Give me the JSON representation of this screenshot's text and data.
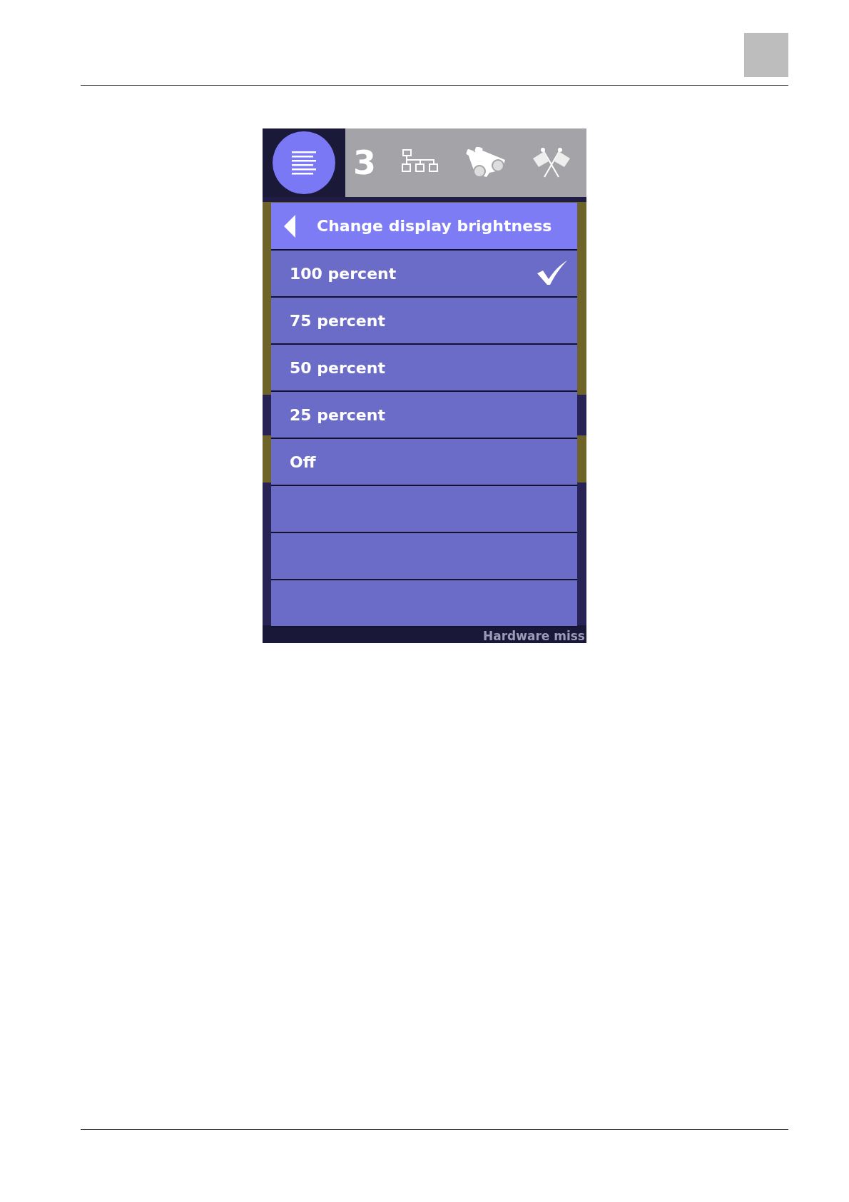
{
  "toolbar": {
    "tabs": [
      {
        "kind": "menu",
        "selected": true
      },
      {
        "kind": "count",
        "label": "3",
        "selected": false
      },
      {
        "kind": "network",
        "selected": false
      },
      {
        "kind": "binoculars",
        "selected": false
      },
      {
        "kind": "flags",
        "selected": false
      }
    ]
  },
  "background": {
    "bands": [
      {
        "kind": "alert"
      },
      {
        "kind": "normal"
      },
      {
        "kind": "alert"
      },
      {
        "kind": "normal"
      }
    ],
    "footer_text": "Hardware miss"
  },
  "menu": {
    "title": "Change display brightness",
    "items": [
      {
        "kind": "option",
        "label": "100 percent",
        "selected": true
      },
      {
        "kind": "option",
        "label": "75 percent",
        "selected": false
      },
      {
        "kind": "option",
        "label": "50 percent",
        "selected": false
      },
      {
        "kind": "option",
        "label": "25 percent",
        "selected": false
      },
      {
        "kind": "option",
        "label": "Off",
        "selected": false
      },
      {
        "kind": "blank",
        "selected": false
      },
      {
        "kind": "blank",
        "selected": false
      },
      {
        "kind": "blank",
        "selected": false
      }
    ]
  }
}
